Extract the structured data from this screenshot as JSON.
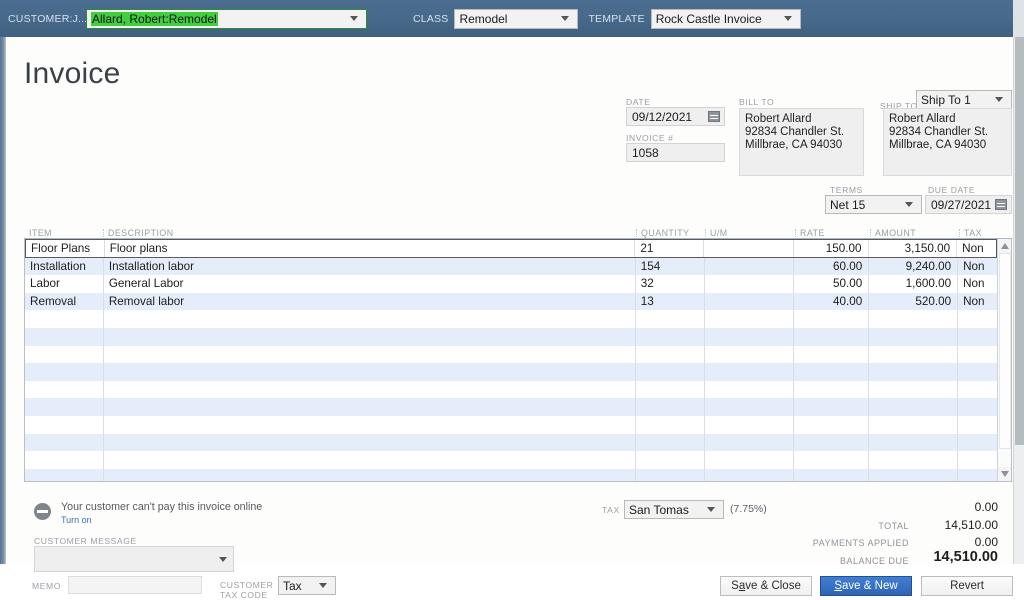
{
  "ribbon": {
    "customer_label": "CUSTOMER:J...",
    "customer_value": "Allard, Robert:Remodel",
    "class_label": "CLASS",
    "class_value": "Remodel",
    "template_label": "TEMPLATE",
    "template_value": "Rock Castle Invoice"
  },
  "header": {
    "title": "Invoice",
    "date_label": "DATE",
    "date_value": "09/12/2021",
    "invoice_no_label": "INVOICE #",
    "invoice_no_value": "1058",
    "bill_to_label": "BILL TO",
    "bill_to_lines": [
      "Robert Allard",
      "92834 Chandler St.",
      "Millbrae, CA 94030"
    ],
    "ship_to_label": "SHIP TO",
    "ship_to_select": "Ship To 1",
    "ship_to_lines": [
      "Robert Allard",
      "92834 Chandler St.",
      "Millbrae, CA 94030"
    ],
    "terms_label": "TERMS",
    "terms_value": "Net 15",
    "due_date_label": "DUE DATE",
    "due_date_value": "09/27/2021"
  },
  "grid": {
    "columns": [
      "ITEM",
      "DESCRIPTION",
      "QUANTITY",
      "U/M",
      "RATE",
      "AMOUNT",
      "TAX"
    ],
    "rows": [
      {
        "item": "Floor Plans",
        "description": "Floor plans",
        "quantity": "21",
        "um": "",
        "rate": "150.00",
        "amount": "3,150.00",
        "tax": "Non"
      },
      {
        "item": "Installation",
        "description": "Installation labor",
        "quantity": "154",
        "um": "",
        "rate": "60.00",
        "amount": "9,240.00",
        "tax": "Non"
      },
      {
        "item": "Labor",
        "description": "General Labor",
        "quantity": "32",
        "um": "",
        "rate": "50.00",
        "amount": "1,600.00",
        "tax": "Non"
      },
      {
        "item": "Removal",
        "description": "Removal labor",
        "quantity": "13",
        "um": "",
        "rate": "40.00",
        "amount": "520.00",
        "tax": "Non"
      }
    ],
    "empty_row_count": 10
  },
  "footer": {
    "pay_notice": "Your customer can't pay this invoice online",
    "pay_link": "Turn on",
    "customer_message_label": "CUSTOMER MESSAGE",
    "customer_message_value": "",
    "memo_label": "MEMO",
    "memo_value": "",
    "customer_tax_code_label_1": "CUSTOMER",
    "customer_tax_code_label_2": "TAX CODE",
    "customer_tax_code_value": "Tax",
    "tax_label": "TAX",
    "tax_value": "San Tomas",
    "tax_percent": "(7.75%)",
    "tax_amount": "0.00",
    "total_label": "TOTAL",
    "total_value": "14,510.00",
    "payments_applied_label": "PAYMENTS APPLIED",
    "payments_applied_value": "0.00",
    "balance_due_label": "BALANCE DUE",
    "balance_due_value": "14,510.00",
    "save_close_label": "Save & Close",
    "save_new_label": "Save & New",
    "revert_label": "Revert"
  },
  "colors": {
    "ribbon": "#47698b",
    "primary_button": "#2f64b4",
    "row_alt": "#e4edf9",
    "selection_green": "#3fcf3f"
  }
}
